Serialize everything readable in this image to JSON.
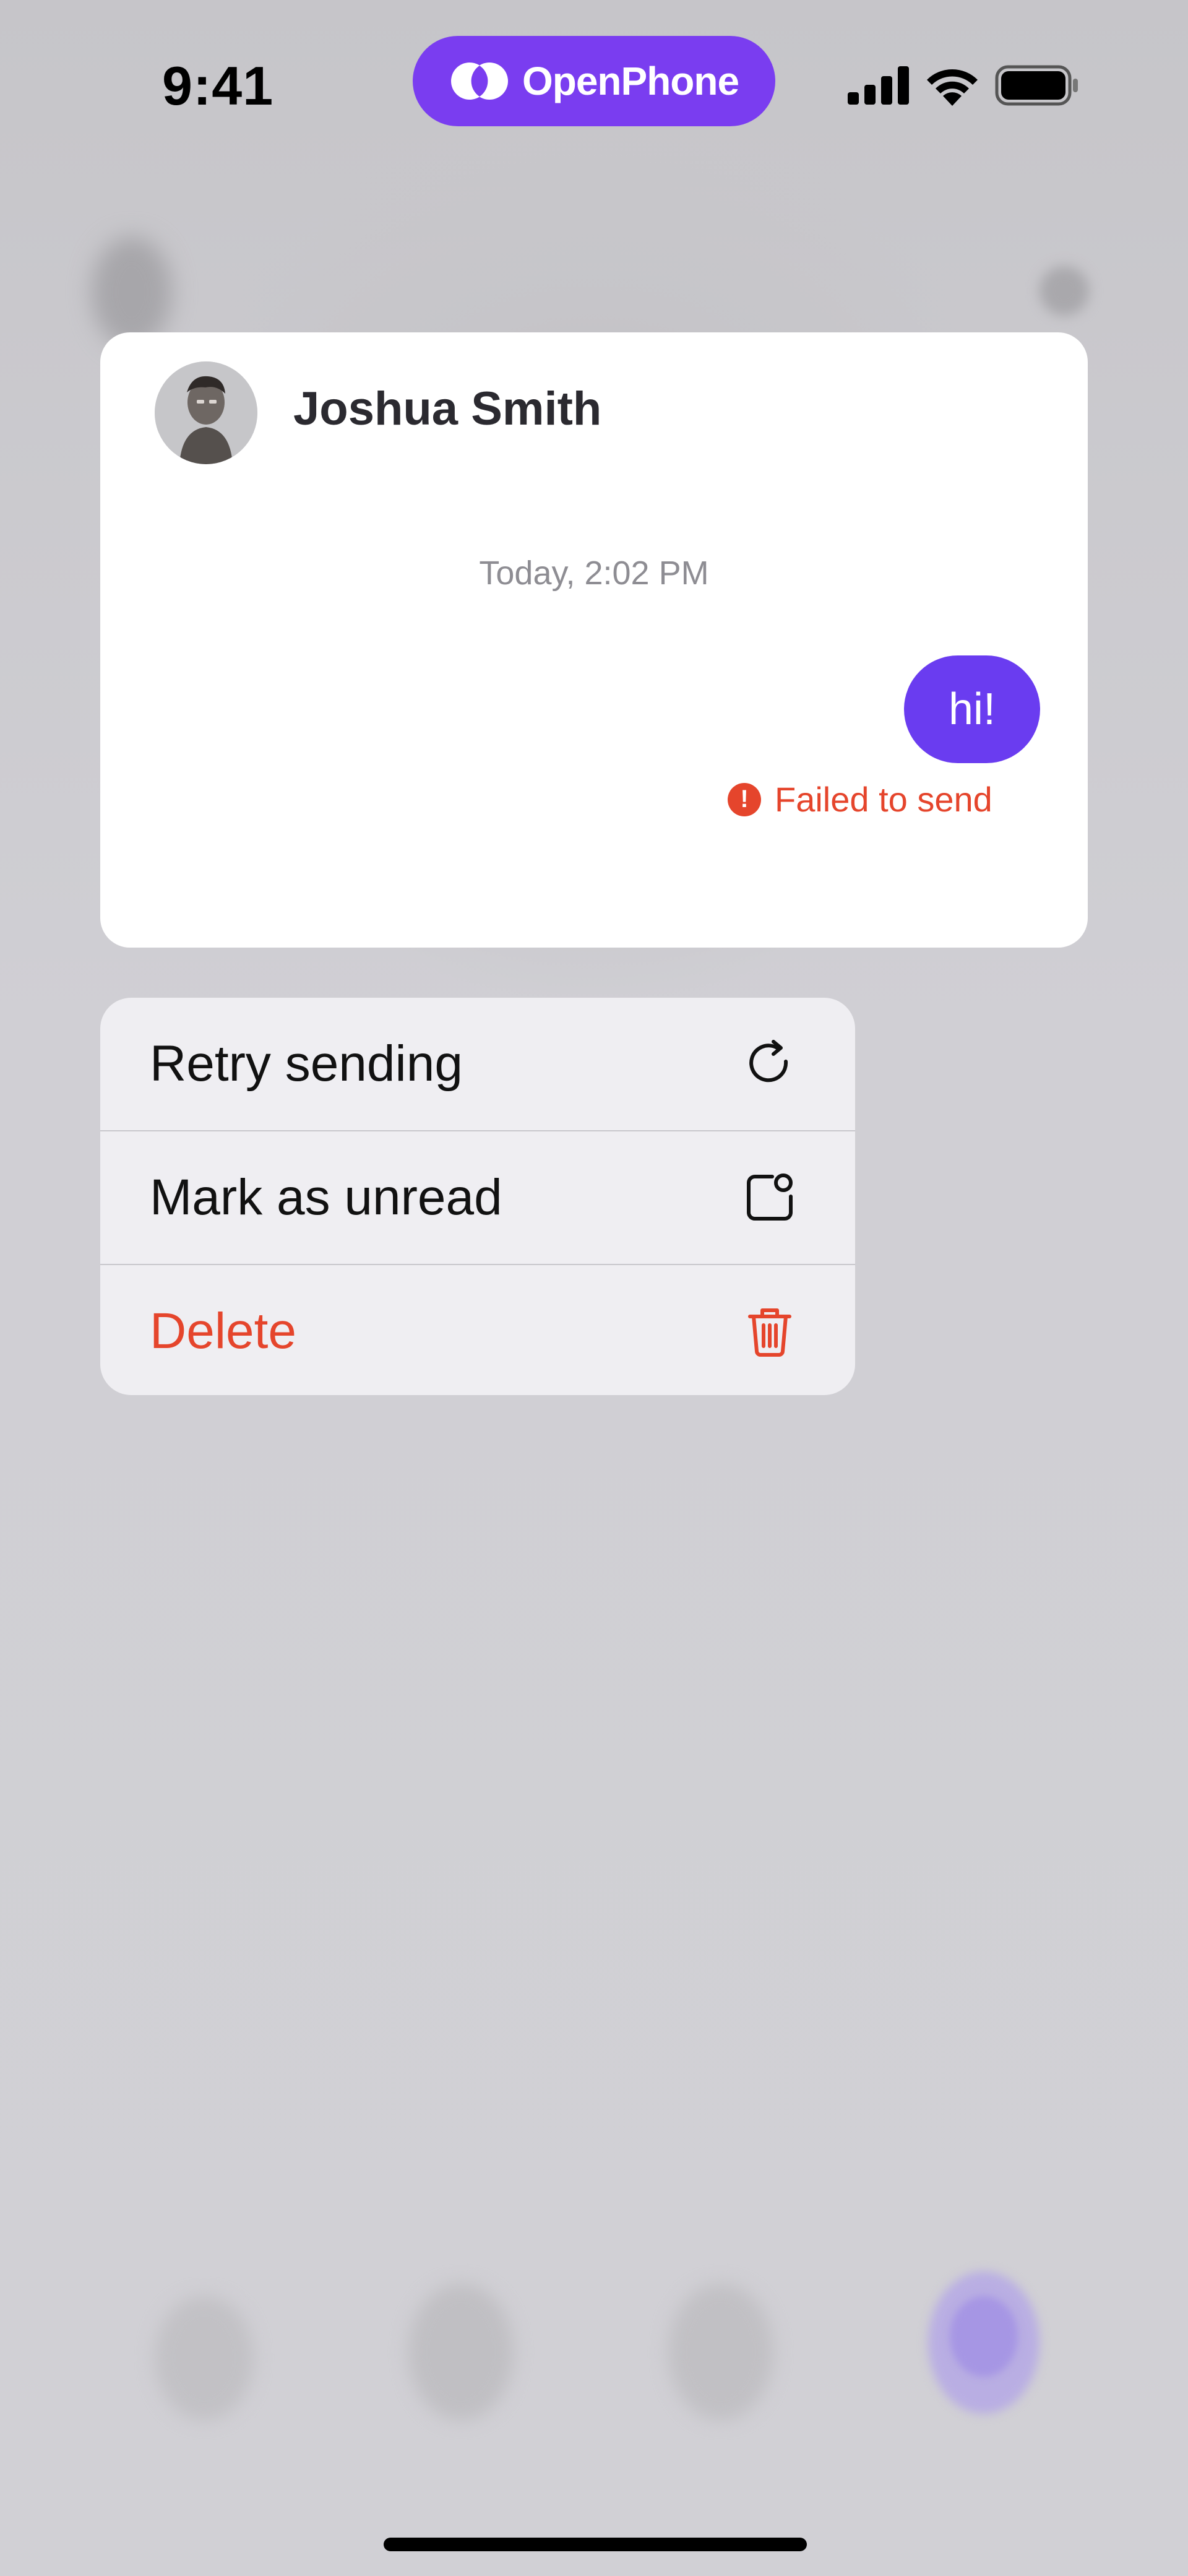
{
  "status_bar": {
    "time": "9:41",
    "island_label": "OpenPhone",
    "icons": [
      "cellular-signal-icon",
      "wifi-icon",
      "battery-icon"
    ]
  },
  "conversation": {
    "contact_name": "Joshua Smith",
    "timestamp": "Today, 2:02 PM",
    "message": "hi!",
    "status": "Failed to send",
    "status_icon": "!"
  },
  "context_menu": {
    "items": [
      {
        "label": "Retry sending",
        "icon": "retry-icon"
      },
      {
        "label": "Mark as unread",
        "icon": "mark-unread-icon"
      },
      {
        "label": "Delete",
        "icon": "trash-icon"
      }
    ]
  },
  "colors": {
    "accent": "#6a3cf0",
    "island": "#7a3df0",
    "error": "#e5452c"
  }
}
